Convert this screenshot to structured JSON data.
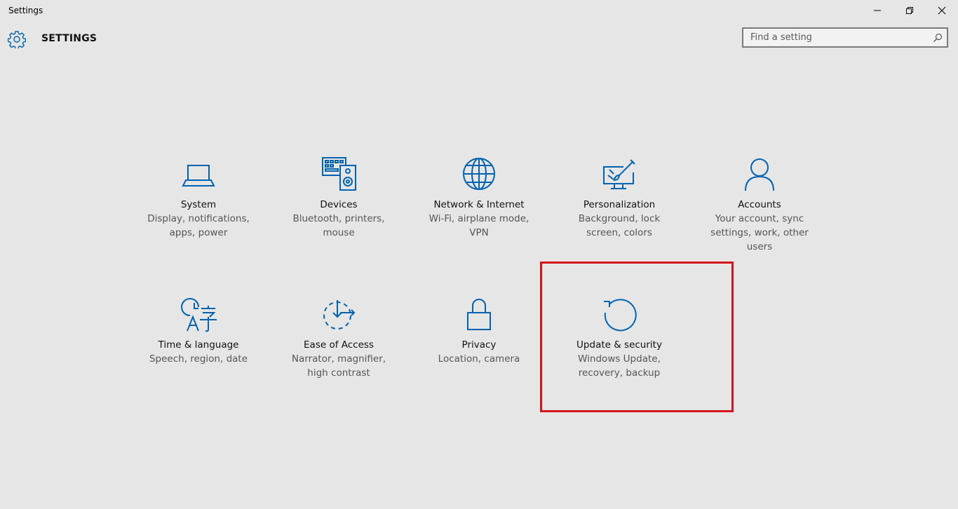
{
  "window": {
    "title": "Settings",
    "minimize_icon": "minimize-icon",
    "maximize_icon": "restore-icon",
    "close_icon": "close-icon"
  },
  "header": {
    "icon": "gear-icon",
    "title": "SETTINGS",
    "search": {
      "placeholder": "Find a setting",
      "value": "",
      "icon": "search-icon"
    }
  },
  "accent_color": "#0063b1",
  "highlight_color": "#d4161c",
  "categories": [
    {
      "id": "system",
      "icon": "laptop-icon",
      "title": "System",
      "description": "Display, notifications, apps, power"
    },
    {
      "id": "devices",
      "icon": "devices-icon",
      "title": "Devices",
      "description": "Bluetooth, printers, mouse"
    },
    {
      "id": "network",
      "icon": "globe-icon",
      "title": "Network & Internet",
      "description": "Wi-Fi, airplane mode, VPN"
    },
    {
      "id": "personalization",
      "icon": "paintbrush-icon",
      "title": "Personalization",
      "description": "Background, lock screen, colors"
    },
    {
      "id": "accounts",
      "icon": "person-icon",
      "title": "Accounts",
      "description": "Your account, sync settings, work, other users"
    },
    {
      "id": "time-language",
      "icon": "time-language-icon",
      "title": "Time & language",
      "description": "Speech, region, date"
    },
    {
      "id": "ease-of-access",
      "icon": "ease-of-access-icon",
      "title": "Ease of Access",
      "description": "Narrator, magnifier, high contrast"
    },
    {
      "id": "privacy",
      "icon": "lock-icon",
      "title": "Privacy",
      "description": "Location, camera"
    },
    {
      "id": "update-security",
      "icon": "refresh-icon",
      "title": "Update & security",
      "description": "Windows Update, recovery, backup",
      "highlighted": true
    }
  ]
}
